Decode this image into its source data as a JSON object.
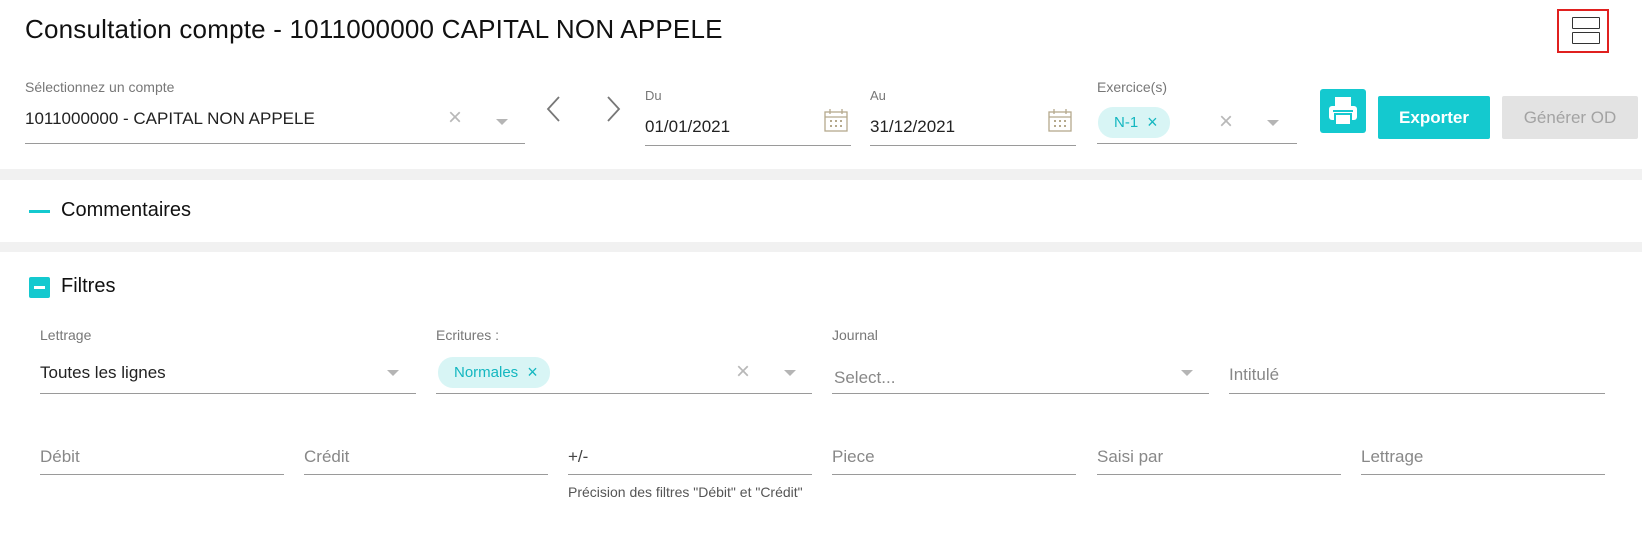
{
  "header": {
    "title": "Consultation compte - 1011000000 CAPITAL NON APPELE"
  },
  "account": {
    "label": "Sélectionnez un compte",
    "value": "1011000000 - CAPITAL NON APPELE"
  },
  "date_from": {
    "label": "Du",
    "value": "01/01/2021"
  },
  "date_to": {
    "label": "Au",
    "value": "31/12/2021"
  },
  "exercices": {
    "label": "Exercice(s)",
    "chips": [
      "N-1"
    ]
  },
  "actions": {
    "export_label": "Exporter",
    "od_label": "Générer OD"
  },
  "sections": {
    "comments": "Commentaires",
    "filters": "Filtres"
  },
  "filters": {
    "lettrage": {
      "label": "Lettrage",
      "value": "Toutes les lignes"
    },
    "ecritures": {
      "label": "Ecritures :",
      "chips": [
        "Normales"
      ]
    },
    "journal": {
      "label": "Journal",
      "placeholder": "Select..."
    },
    "intitule": {
      "placeholder": "Intitulé"
    },
    "debit": {
      "placeholder": "Débit"
    },
    "credit": {
      "placeholder": "Crédit"
    },
    "plusminus": {
      "placeholder": "+/-",
      "hint": "Précision des filtres \"Débit\" et \"Crédit\""
    },
    "piece": {
      "placeholder": "Piece"
    },
    "saisi_par": {
      "placeholder": "Saisi par"
    },
    "lettrage2": {
      "placeholder": "Lettrage"
    }
  },
  "colors": {
    "accent": "#14c9cf",
    "chip_bg": "#d8f5f5",
    "highlight_border": "#e0201f"
  }
}
